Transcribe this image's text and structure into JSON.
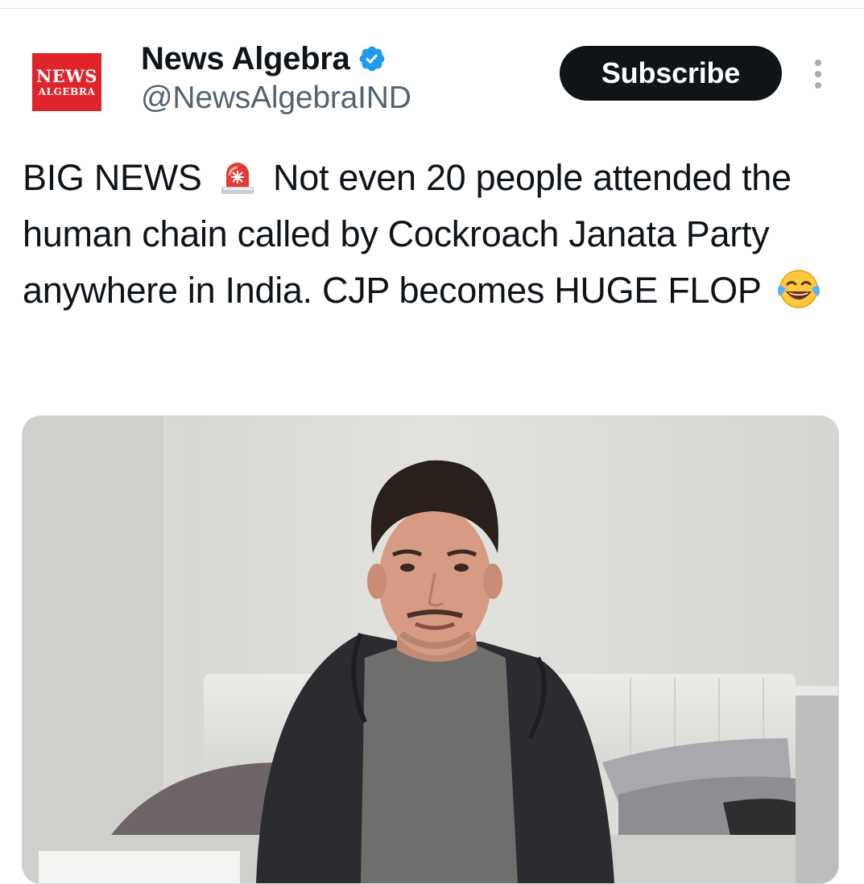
{
  "author": {
    "avatar_line1": "NEWS",
    "avatar_line2": "ALGEBRA",
    "display_name": "News Algebra",
    "handle": "@NewsAlgebraIND",
    "verified": true
  },
  "actions": {
    "subscribe_label": "Subscribe"
  },
  "tweet": {
    "text_part1": "BIG NEWS",
    "emoji1": "police-car-light",
    "text_part2": "Not even 20 people attended the human chain called by Cockroach Janata Party anywhere in India. CJP becomes HUGE FLOP",
    "emoji2": "face-with-tears-of-joy"
  },
  "colors": {
    "verified_blue": "#1d9bf0",
    "avatar_red": "#e0242b",
    "button_dark": "#0f1419",
    "handle_gray": "#536471"
  }
}
